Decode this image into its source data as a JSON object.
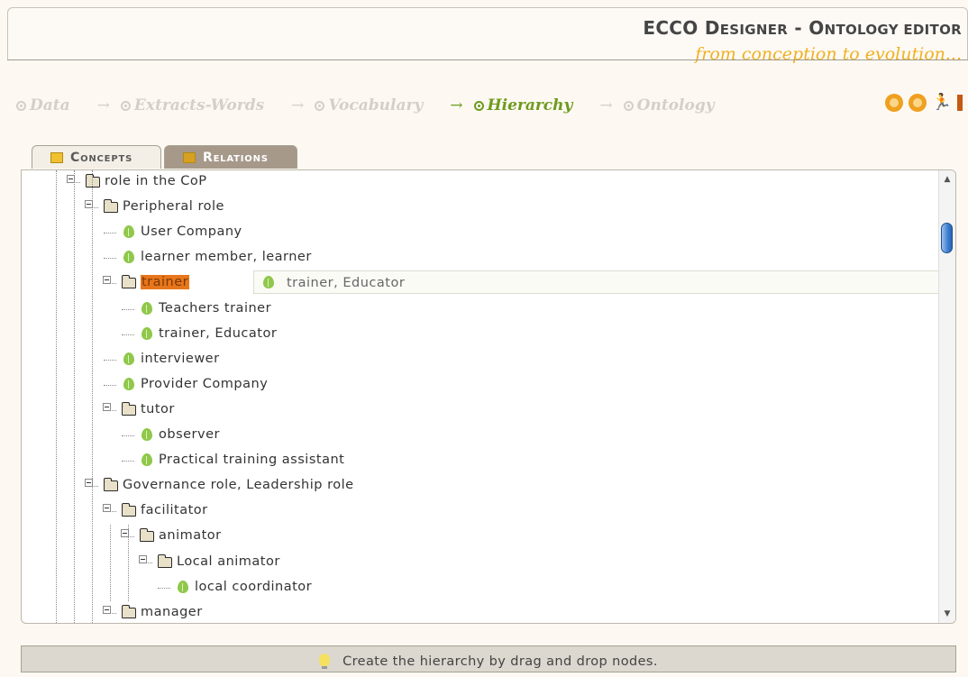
{
  "header": {
    "title_part1": "ECCO D",
    "title_part2": "ESIGNER",
    "title_part3": " - O",
    "title_part4": "NTOLOGY EDITOR",
    "subtitle": "from conception to evolution..."
  },
  "steps": [
    {
      "label": "Data",
      "active": false
    },
    {
      "label": "Extracts-Words",
      "active": false
    },
    {
      "label": "Vocabulary",
      "active": false
    },
    {
      "label": "Hierarchy",
      "active": true
    },
    {
      "label": "Ontology",
      "active": false
    }
  ],
  "tabs": {
    "concepts": "Concepts",
    "relations": "Relations",
    "active": "relations"
  },
  "tree": [
    {
      "label": "role in the CoP",
      "type": "folder",
      "level": 0
    },
    {
      "label": "Peripheral role",
      "type": "folder",
      "level": 1
    },
    {
      "label": "User Company",
      "type": "leaf",
      "level": 2
    },
    {
      "label": "learner member, learner",
      "type": "leaf",
      "level": 2
    },
    {
      "label": "trainer",
      "type": "folder",
      "level": 2,
      "selected": true
    },
    {
      "label": "Teachers trainer",
      "type": "leaf",
      "level": 3
    },
    {
      "label": "trainer, Educator",
      "type": "leaf",
      "level": 3
    },
    {
      "label": "interviewer",
      "type": "leaf",
      "level": 2
    },
    {
      "label": "Provider Company",
      "type": "leaf",
      "level": 2
    },
    {
      "label": "tutor",
      "type": "folder",
      "level": 2
    },
    {
      "label": "observer",
      "type": "leaf",
      "level": 3
    },
    {
      "label": "Practical training assistant",
      "type": "leaf",
      "level": 3
    },
    {
      "label": "Governance role, Leadership role",
      "type": "folder",
      "level": 1
    },
    {
      "label": "facilitator",
      "type": "folder",
      "level": 2
    },
    {
      "label": "animator",
      "type": "folder",
      "level": 3
    },
    {
      "label": "Local animator",
      "type": "folder",
      "level": 4
    },
    {
      "label": "local coordinator",
      "type": "leaf",
      "level": 5
    },
    {
      "label": "manager",
      "type": "folder",
      "level": 2
    }
  ],
  "drag_ghost": {
    "label": "trainer, Educator"
  },
  "footer": {
    "message": "Create the hierarchy by drag and drop nodes."
  },
  "colors": {
    "accent_active": "#6e9a1e",
    "inactive_step": "#d4d0c8",
    "subtitle": "#f0b020",
    "selection": "#e8761a",
    "leaf": "#8fc84a"
  }
}
